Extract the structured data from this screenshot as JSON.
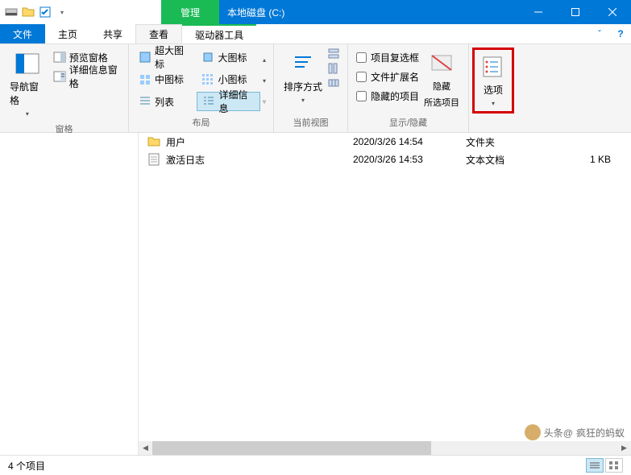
{
  "titlebar": {
    "context_label": "管理",
    "window_title": "本地磁盘 (C:)"
  },
  "tabs": {
    "file": "文件",
    "home": "主页",
    "share": "共享",
    "view": "查看",
    "drive_tools": "驱动器工具"
  },
  "ribbon": {
    "panes": {
      "nav_pane": "导航窗格",
      "preview_pane": "预览窗格",
      "details_pane": "详细信息窗格",
      "group_label": "窗格"
    },
    "layout": {
      "extra_large": "超大图标",
      "large": "大图标",
      "medium": "中图标",
      "small": "小图标",
      "list": "列表",
      "details": "详细信息",
      "group_label": "布局"
    },
    "current_view": {
      "sort_by": "排序方式",
      "group_label": "当前视图"
    },
    "show_hide": {
      "item_checkboxes": "项目复选框",
      "file_ext": "文件扩展名",
      "hidden_items": "隐藏的项目",
      "hide_selected": "隐藏所选项目",
      "hide_selected_1": "隐藏",
      "hide_selected_2": "所选项目",
      "group_label": "显示/隐藏"
    },
    "options": {
      "label": "选项"
    }
  },
  "files": [
    {
      "name": "用户",
      "date": "2020/3/26 14:54",
      "type": "文件夹",
      "size": ""
    },
    {
      "name": "激活日志",
      "date": "2020/3/26 14:53",
      "type": "文本文档",
      "size": "1 KB"
    }
  ],
  "status": {
    "item_count": "4 个项目"
  },
  "watermark": {
    "prefix": "头条@",
    "name": "疯狂的蚂蚁"
  }
}
